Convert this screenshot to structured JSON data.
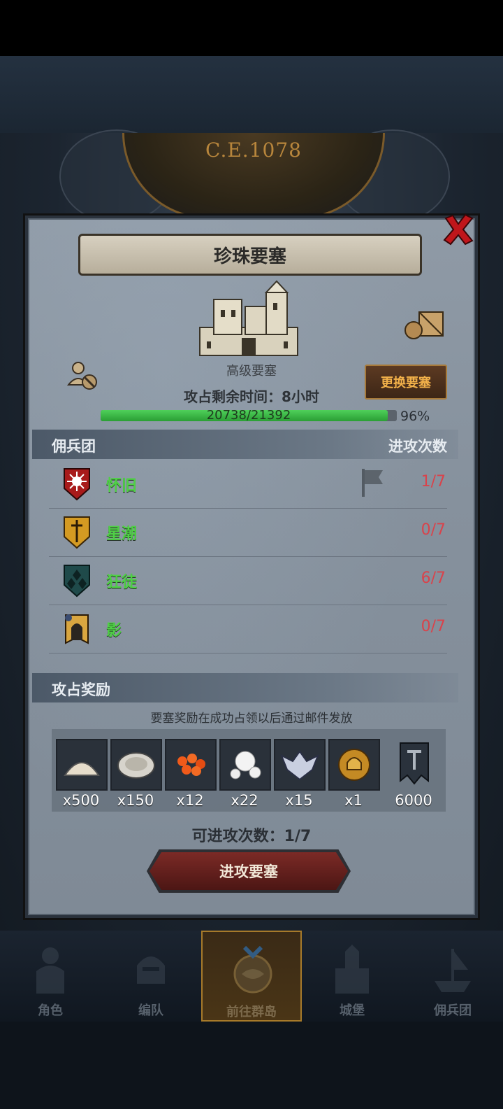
{
  "era": {
    "label": "C.E.1078"
  },
  "dialog": {
    "title": "珍珠要塞",
    "fortress_grade": "高级要塞",
    "capture_time": "攻占剩余时间：8小时",
    "change_button": "更换要塞",
    "progress": {
      "text": "20738/21392",
      "percent_label": "96%",
      "fraction": 0.969
    }
  },
  "mercenary_section": {
    "title": "佣兵团",
    "count_header": "进攻次数",
    "rows": [
      {
        "name": "怀旧",
        "count": "1/7",
        "emblem": "red-sun-shield-icon",
        "flagged": true
      },
      {
        "name": "星潮",
        "count": "0/7",
        "emblem": "gold-sword-shield-icon",
        "flagged": false
      },
      {
        "name": "狂徒",
        "count": "6/7",
        "emblem": "teal-diamond-shield-icon",
        "flagged": false
      },
      {
        "name": "影",
        "count": "0/7",
        "emblem": "shadow-arch-banner-icon",
        "flagged": false
      }
    ]
  },
  "reward_section": {
    "title": "攻占奖励",
    "note": "要塞奖励在成功占领以后通过邮件发放",
    "items": [
      {
        "icon": "salt-pile-icon",
        "qty": "x500"
      },
      {
        "icon": "oyster-icon",
        "qty": "x150"
      },
      {
        "icon": "roe-icon",
        "qty": "x12"
      },
      {
        "icon": "pearl-icon",
        "qty": "x22"
      },
      {
        "icon": "winged-emblem-icon",
        "qty": "x15"
      },
      {
        "icon": "gold-helmet-coin-icon",
        "qty": "x1"
      },
      {
        "icon": "guild-banner-icon",
        "qty": "6000"
      }
    ]
  },
  "attack": {
    "remaining": "可进攻次数：1/7",
    "button": "进攻要塞"
  },
  "nav": {
    "items": [
      {
        "label": "角色",
        "active": false
      },
      {
        "label": "编队",
        "active": false
      },
      {
        "label": "前往群岛",
        "active": true
      },
      {
        "label": "城堡",
        "active": false
      },
      {
        "label": "佣兵团",
        "active": false
      }
    ]
  },
  "colors": {
    "merc_name": "#4fd046",
    "merc_count": "#d9434b",
    "progress": "#3fbf4a",
    "accent_gold": "#f2b14a"
  }
}
